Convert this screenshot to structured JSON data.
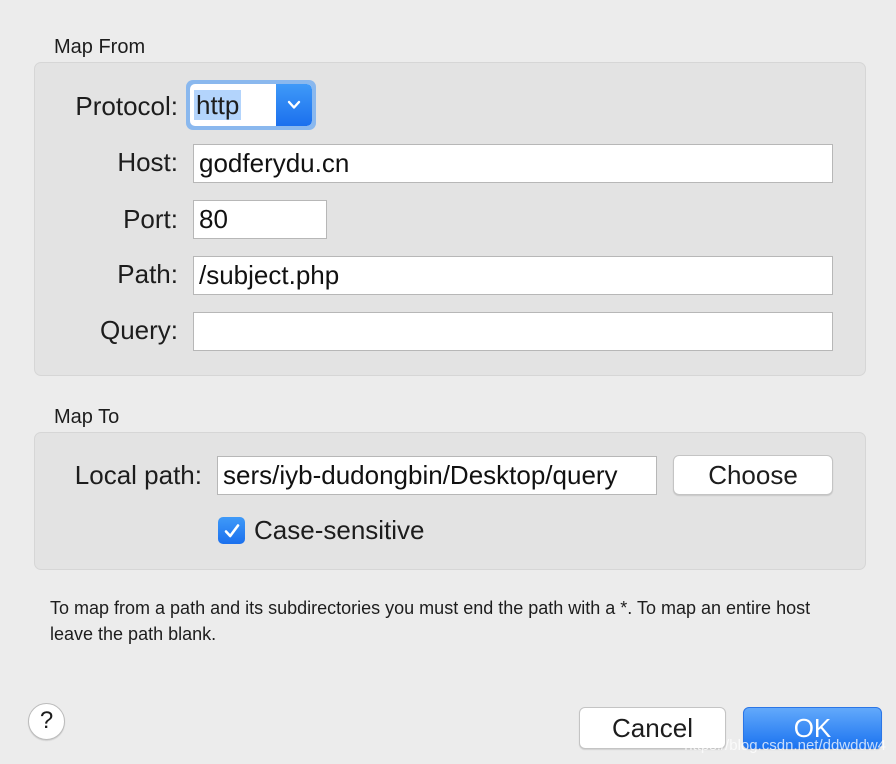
{
  "map_from": {
    "title": "Map From",
    "protocol_label": "Protocol:",
    "protocol_value": "http",
    "host_label": "Host:",
    "host_value": "godferydu.cn",
    "port_label": "Port:",
    "port_value": "80",
    "path_label": "Path:",
    "path_value": "/subject.php",
    "query_label": "Query:",
    "query_value": ""
  },
  "map_to": {
    "title": "Map To",
    "local_path_label": "Local path:",
    "local_path_value": "sers/iyb-dudongbin/Desktop/query",
    "choose_label": "Choose",
    "case_sensitive_label": "Case-sensitive",
    "case_sensitive_checked": true
  },
  "note": "To map from a path and its subdirectories you must end the path with a *. To map an entire host leave the path blank.",
  "footer": {
    "help_label": "?",
    "cancel_label": "Cancel",
    "ok_label": "OK"
  },
  "watermark": "https://blog.csdn.net/ddwddw4",
  "colors": {
    "accent": "#1b73f0",
    "background": "#ececec",
    "group_background": "#e3e3e3"
  }
}
